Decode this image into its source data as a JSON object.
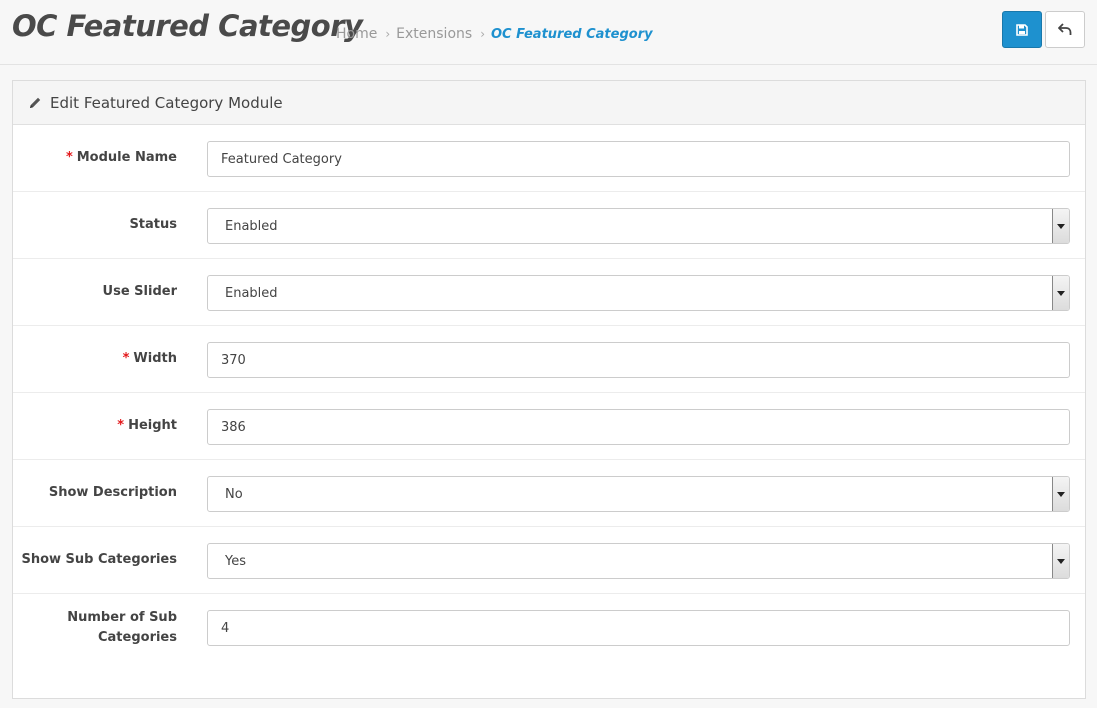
{
  "header": {
    "title": "OC Featured Category",
    "breadcrumb": [
      {
        "label": "Home"
      },
      {
        "label": "Extensions"
      },
      {
        "label": "OC Featured Category"
      }
    ],
    "save_icon": "save-icon",
    "back_icon": "reply-icon"
  },
  "panel": {
    "title": "Edit Featured Category Module",
    "icon": "pencil-icon"
  },
  "form": {
    "module_name": {
      "label": "Module Name",
      "required": true,
      "value": "Featured Category"
    },
    "status": {
      "label": "Status",
      "value": "Enabled"
    },
    "use_slider": {
      "label": "Use Slider",
      "value": "Enabled"
    },
    "width": {
      "label": "Width",
      "required": true,
      "value": "370"
    },
    "height": {
      "label": "Height",
      "required": true,
      "value": "386"
    },
    "show_description": {
      "label": "Show Description",
      "value": "No"
    },
    "show_sub_categories": {
      "label": "Show Sub Categories",
      "value": "Yes"
    },
    "number_of_sub_categories": {
      "label": "Number of Sub Categories",
      "value": "4"
    }
  },
  "colors": {
    "primary": "#1e91cf",
    "required": "#e3171a"
  }
}
